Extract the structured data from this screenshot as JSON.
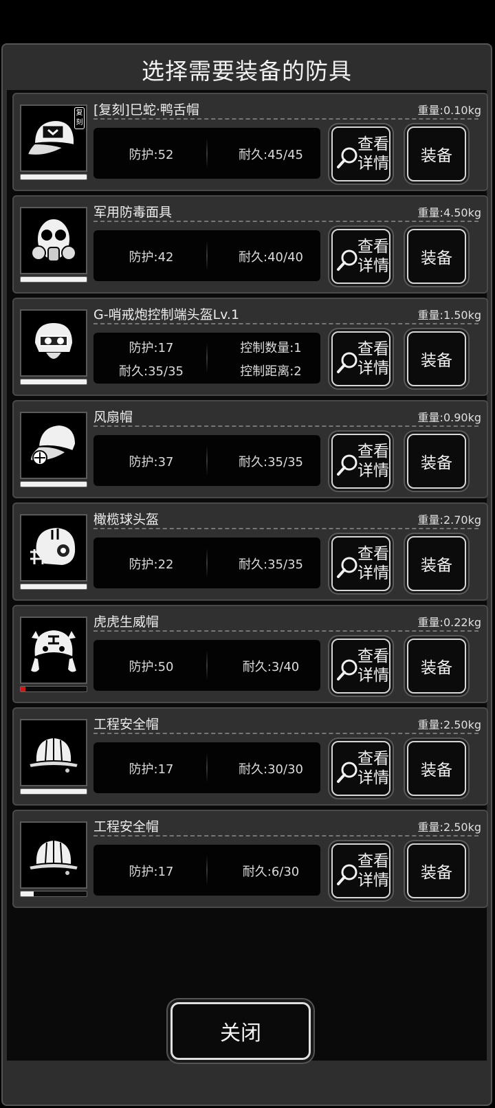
{
  "dialog": {
    "title": "选择需要装备的防具",
    "close_label": "关闭"
  },
  "buttons": {
    "detail_line1": "查看",
    "detail_line2": "详情",
    "equip": "装备"
  },
  "items": [
    {
      "name": "[复刻]巳蛇·鸭舌帽",
      "weight": "重量:0.10kg",
      "icon": "baseball-cap-icon",
      "tag": "复刻",
      "durability_fraction": 1.0,
      "stats": [
        "防护:52",
        "耐久:45/45"
      ]
    },
    {
      "name": "军用防毒面具",
      "weight": "重量:4.50kg",
      "icon": "gas-mask-icon",
      "durability_fraction": 1.0,
      "stats": [
        "防护:42",
        "耐久:40/40"
      ]
    },
    {
      "name": "G-哨戒炮控制端头盔Lv.1",
      "weight": "重量:1.50kg",
      "icon": "sentry-control-helmet-icon",
      "durability_fraction": 1.0,
      "stats": [
        "防护:17",
        "控制数量:1",
        "耐久:35/35",
        "控制距离:2"
      ]
    },
    {
      "name": "风扇帽",
      "weight": "重量:0.90kg",
      "icon": "fan-cap-icon",
      "durability_fraction": 1.0,
      "stats": [
        "防护:37",
        "耐久:35/35"
      ]
    },
    {
      "name": "橄榄球头盔",
      "weight": "重量:2.70kg",
      "icon": "football-helmet-icon",
      "durability_fraction": 1.0,
      "stats": [
        "防护:22",
        "耐久:35/35"
      ]
    },
    {
      "name": "虎虎生威帽",
      "weight": "重量:0.22kg",
      "icon": "tiger-hat-icon",
      "durability_fraction": 0.075,
      "stats": [
        "防护:50",
        "耐久:3/40"
      ]
    },
    {
      "name": "工程安全帽",
      "weight": "重量:2.50kg",
      "icon": "hard-hat-icon",
      "durability_fraction": 1.0,
      "stats": [
        "防护:17",
        "耐久:30/30"
      ]
    },
    {
      "name": "工程安全帽",
      "weight": "重量:2.50kg",
      "icon": "hard-hat-icon",
      "durability_fraction": 0.2,
      "stats": [
        "防护:17",
        "耐久:6/30"
      ]
    }
  ]
}
